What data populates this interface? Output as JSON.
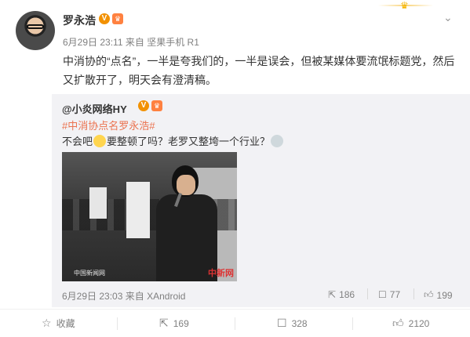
{
  "post": {
    "author_name": "罗永浩",
    "verified_icon": "v-verified-icon",
    "vip_icon": "crown-vip-icon",
    "timestamp": "6月29日 23:11",
    "source_prefix": "来自",
    "source": "坚果手机 R1",
    "text": "中消协的“点名”，一半是夸我们的，一半是误会，但被某媒体要流氓标题党，然后又扩散开了，明天会有澄清稿。"
  },
  "repost": {
    "user": "@小炎网络HY",
    "hashtag": "#中消协点名罗永浩#",
    "text_part1": "不会吧",
    "text_part2": "要整顿了吗？老罗又整垮一个行业？",
    "photo_watermark_left": "中国新闻网",
    "photo_watermark_right": "中新网",
    "timestamp": "6月29日 23:03",
    "source_prefix": "来自",
    "source": "XAndroid",
    "reposts": "186",
    "comments": "77",
    "likes": "199"
  },
  "actions": {
    "favorite_label": "收藏",
    "repost_count": "169",
    "comment_count": "328",
    "like_count": "2120"
  },
  "colors": {
    "accent_orange": "#eb7350",
    "verified_badge": "#f29100",
    "text_gray": "#808080"
  }
}
